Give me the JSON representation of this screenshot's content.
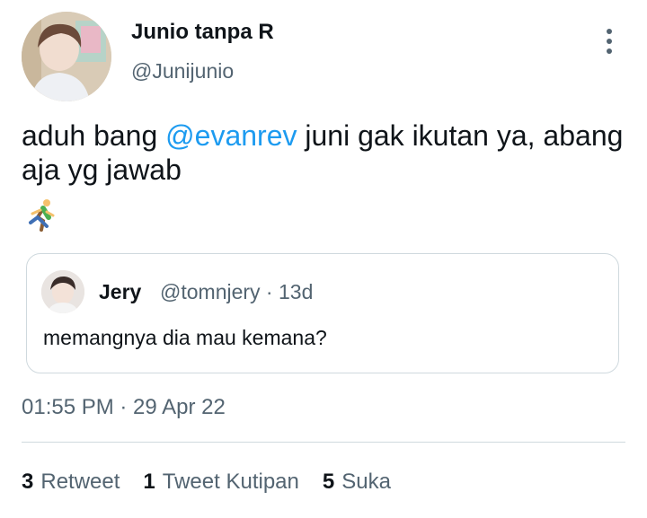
{
  "tweet": {
    "author_name": "Junio tanpa R",
    "author_handle": "@Junijunio",
    "text_before": "aduh bang ",
    "mention": "@evanrev",
    "text_after": " juni gak ikutan ya, abang aja yg jawab",
    "emoji": "person-running-emoji",
    "timestamp": "01:55 PM · 29 Apr 22"
  },
  "quote": {
    "name": "Jery",
    "handle_time": "@tomnjery · 13d",
    "text": "memangnya dia mau kemana?"
  },
  "stats": {
    "retweets_count": "3",
    "retweets_label": "Retweet",
    "quotes_count": "1",
    "quotes_label": "Tweet Kutipan",
    "likes_count": "5",
    "likes_label": "Suka"
  },
  "colors": {
    "accent": "#1d9bf0",
    "secondary_text": "#536471",
    "border": "#cfd9de"
  }
}
